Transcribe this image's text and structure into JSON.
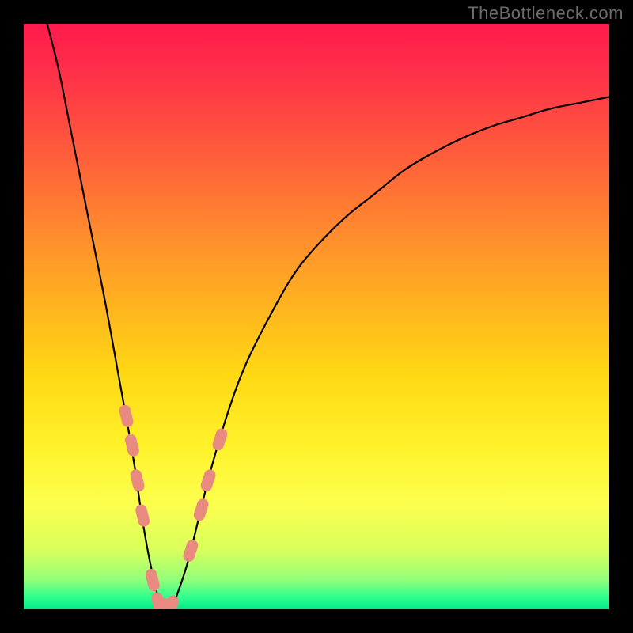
{
  "watermark": "TheBottleneck.com",
  "colors": {
    "frame": "#000000",
    "marker": "#e98a80",
    "line": "#000000"
  },
  "chart_data": {
    "type": "line",
    "title": "",
    "xlabel": "",
    "ylabel": "",
    "xlim": [
      0,
      100
    ],
    "ylim": [
      0,
      100
    ],
    "x": [
      4,
      6,
      8,
      10,
      12,
      14,
      16,
      18,
      19,
      20,
      21,
      22,
      23,
      24,
      25,
      26,
      28,
      30,
      32,
      35,
      38,
      42,
      46,
      50,
      55,
      60,
      65,
      70,
      75,
      80,
      85,
      90,
      95,
      100
    ],
    "y": [
      100,
      92,
      82,
      72,
      62,
      52,
      41,
      30,
      24,
      17,
      11,
      6,
      2,
      0,
      0,
      2,
      8,
      16,
      24,
      34,
      42,
      50,
      57,
      62,
      67,
      71,
      75,
      78,
      80.5,
      82.5,
      84,
      85.5,
      86.5,
      87.5
    ],
    "markers": {
      "x": [
        17.5,
        18.5,
        19.4,
        20.3,
        22.0,
        23.0,
        24.0,
        25.2,
        28.5,
        30.3,
        31.5,
        33.5
      ],
      "y": [
        33,
        28,
        22,
        16,
        5,
        1,
        0,
        0.5,
        10,
        17,
        22,
        29
      ]
    },
    "annotations": []
  }
}
